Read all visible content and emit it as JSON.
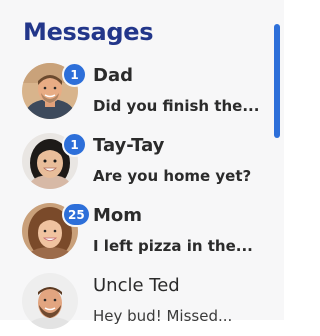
{
  "header": {
    "title": "Messages"
  },
  "colors": {
    "accent": "#2d6fd9",
    "title": "#22368a"
  },
  "conversations": [
    {
      "name": "Dad",
      "preview": "Did you finish the...",
      "unread": "1",
      "avatar": "avatar-dad"
    },
    {
      "name": "Tay-Tay",
      "preview": "Are you home yet?",
      "unread": "1",
      "avatar": "avatar-tay"
    },
    {
      "name": "Mom",
      "preview": "I left pizza in the...",
      "unread": "25",
      "avatar": "avatar-mom"
    },
    {
      "name": "Uncle Ted",
      "preview": "Hey bud! Missed...",
      "avatar": "avatar-ted"
    }
  ]
}
